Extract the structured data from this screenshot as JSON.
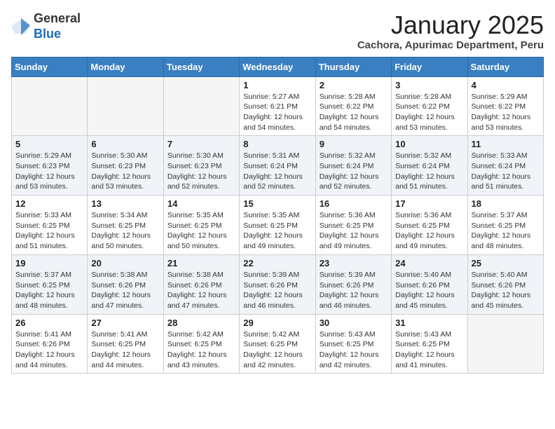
{
  "logo": {
    "general": "General",
    "blue": "Blue"
  },
  "header": {
    "title": "January 2025",
    "subtitle": "Cachora, Apurimac Department, Peru"
  },
  "weekdays": [
    "Sunday",
    "Monday",
    "Tuesday",
    "Wednesday",
    "Thursday",
    "Friday",
    "Saturday"
  ],
  "weeks": [
    [
      {
        "day": "",
        "sunrise": "",
        "sunset": "",
        "daylight": "",
        "empty": true
      },
      {
        "day": "",
        "sunrise": "",
        "sunset": "",
        "daylight": "",
        "empty": true
      },
      {
        "day": "",
        "sunrise": "",
        "sunset": "",
        "daylight": "",
        "empty": true
      },
      {
        "day": "1",
        "sunrise": "Sunrise: 5:27 AM",
        "sunset": "Sunset: 6:21 PM",
        "daylight": "Daylight: 12 hours and 54 minutes."
      },
      {
        "day": "2",
        "sunrise": "Sunrise: 5:28 AM",
        "sunset": "Sunset: 6:22 PM",
        "daylight": "Daylight: 12 hours and 54 minutes."
      },
      {
        "day": "3",
        "sunrise": "Sunrise: 5:28 AM",
        "sunset": "Sunset: 6:22 PM",
        "daylight": "Daylight: 12 hours and 53 minutes."
      },
      {
        "day": "4",
        "sunrise": "Sunrise: 5:29 AM",
        "sunset": "Sunset: 6:22 PM",
        "daylight": "Daylight: 12 hours and 53 minutes."
      }
    ],
    [
      {
        "day": "5",
        "sunrise": "Sunrise: 5:29 AM",
        "sunset": "Sunset: 6:23 PM",
        "daylight": "Daylight: 12 hours and 53 minutes."
      },
      {
        "day": "6",
        "sunrise": "Sunrise: 5:30 AM",
        "sunset": "Sunset: 6:23 PM",
        "daylight": "Daylight: 12 hours and 53 minutes."
      },
      {
        "day": "7",
        "sunrise": "Sunrise: 5:30 AM",
        "sunset": "Sunset: 6:23 PM",
        "daylight": "Daylight: 12 hours and 52 minutes."
      },
      {
        "day": "8",
        "sunrise": "Sunrise: 5:31 AM",
        "sunset": "Sunset: 6:24 PM",
        "daylight": "Daylight: 12 hours and 52 minutes."
      },
      {
        "day": "9",
        "sunrise": "Sunrise: 5:32 AM",
        "sunset": "Sunset: 6:24 PM",
        "daylight": "Daylight: 12 hours and 52 minutes."
      },
      {
        "day": "10",
        "sunrise": "Sunrise: 5:32 AM",
        "sunset": "Sunset: 6:24 PM",
        "daylight": "Daylight: 12 hours and 51 minutes."
      },
      {
        "day": "11",
        "sunrise": "Sunrise: 5:33 AM",
        "sunset": "Sunset: 6:24 PM",
        "daylight": "Daylight: 12 hours and 51 minutes."
      }
    ],
    [
      {
        "day": "12",
        "sunrise": "Sunrise: 5:33 AM",
        "sunset": "Sunset: 6:25 PM",
        "daylight": "Daylight: 12 hours and 51 minutes."
      },
      {
        "day": "13",
        "sunrise": "Sunrise: 5:34 AM",
        "sunset": "Sunset: 6:25 PM",
        "daylight": "Daylight: 12 hours and 50 minutes."
      },
      {
        "day": "14",
        "sunrise": "Sunrise: 5:35 AM",
        "sunset": "Sunset: 6:25 PM",
        "daylight": "Daylight: 12 hours and 50 minutes."
      },
      {
        "day": "15",
        "sunrise": "Sunrise: 5:35 AM",
        "sunset": "Sunset: 6:25 PM",
        "daylight": "Daylight: 12 hours and 49 minutes."
      },
      {
        "day": "16",
        "sunrise": "Sunrise: 5:36 AM",
        "sunset": "Sunset: 6:25 PM",
        "daylight": "Daylight: 12 hours and 49 minutes."
      },
      {
        "day": "17",
        "sunrise": "Sunrise: 5:36 AM",
        "sunset": "Sunset: 6:25 PM",
        "daylight": "Daylight: 12 hours and 49 minutes."
      },
      {
        "day": "18",
        "sunrise": "Sunrise: 5:37 AM",
        "sunset": "Sunset: 6:25 PM",
        "daylight": "Daylight: 12 hours and 48 minutes."
      }
    ],
    [
      {
        "day": "19",
        "sunrise": "Sunrise: 5:37 AM",
        "sunset": "Sunset: 6:25 PM",
        "daylight": "Daylight: 12 hours and 48 minutes."
      },
      {
        "day": "20",
        "sunrise": "Sunrise: 5:38 AM",
        "sunset": "Sunset: 6:26 PM",
        "daylight": "Daylight: 12 hours and 47 minutes."
      },
      {
        "day": "21",
        "sunrise": "Sunrise: 5:38 AM",
        "sunset": "Sunset: 6:26 PM",
        "daylight": "Daylight: 12 hours and 47 minutes."
      },
      {
        "day": "22",
        "sunrise": "Sunrise: 5:39 AM",
        "sunset": "Sunset: 6:26 PM",
        "daylight": "Daylight: 12 hours and 46 minutes."
      },
      {
        "day": "23",
        "sunrise": "Sunrise: 5:39 AM",
        "sunset": "Sunset: 6:26 PM",
        "daylight": "Daylight: 12 hours and 46 minutes."
      },
      {
        "day": "24",
        "sunrise": "Sunrise: 5:40 AM",
        "sunset": "Sunset: 6:26 PM",
        "daylight": "Daylight: 12 hours and 45 minutes."
      },
      {
        "day": "25",
        "sunrise": "Sunrise: 5:40 AM",
        "sunset": "Sunset: 6:26 PM",
        "daylight": "Daylight: 12 hours and 45 minutes."
      }
    ],
    [
      {
        "day": "26",
        "sunrise": "Sunrise: 5:41 AM",
        "sunset": "Sunset: 6:26 PM",
        "daylight": "Daylight: 12 hours and 44 minutes."
      },
      {
        "day": "27",
        "sunrise": "Sunrise: 5:41 AM",
        "sunset": "Sunset: 6:25 PM",
        "daylight": "Daylight: 12 hours and 44 minutes."
      },
      {
        "day": "28",
        "sunrise": "Sunrise: 5:42 AM",
        "sunset": "Sunset: 6:25 PM",
        "daylight": "Daylight: 12 hours and 43 minutes."
      },
      {
        "day": "29",
        "sunrise": "Sunrise: 5:42 AM",
        "sunset": "Sunset: 6:25 PM",
        "daylight": "Daylight: 12 hours and 42 minutes."
      },
      {
        "day": "30",
        "sunrise": "Sunrise: 5:43 AM",
        "sunset": "Sunset: 6:25 PM",
        "daylight": "Daylight: 12 hours and 42 minutes."
      },
      {
        "day": "31",
        "sunrise": "Sunrise: 5:43 AM",
        "sunset": "Sunset: 6:25 PM",
        "daylight": "Daylight: 12 hours and 41 minutes."
      },
      {
        "day": "",
        "sunrise": "",
        "sunset": "",
        "daylight": "",
        "empty": true
      }
    ]
  ]
}
